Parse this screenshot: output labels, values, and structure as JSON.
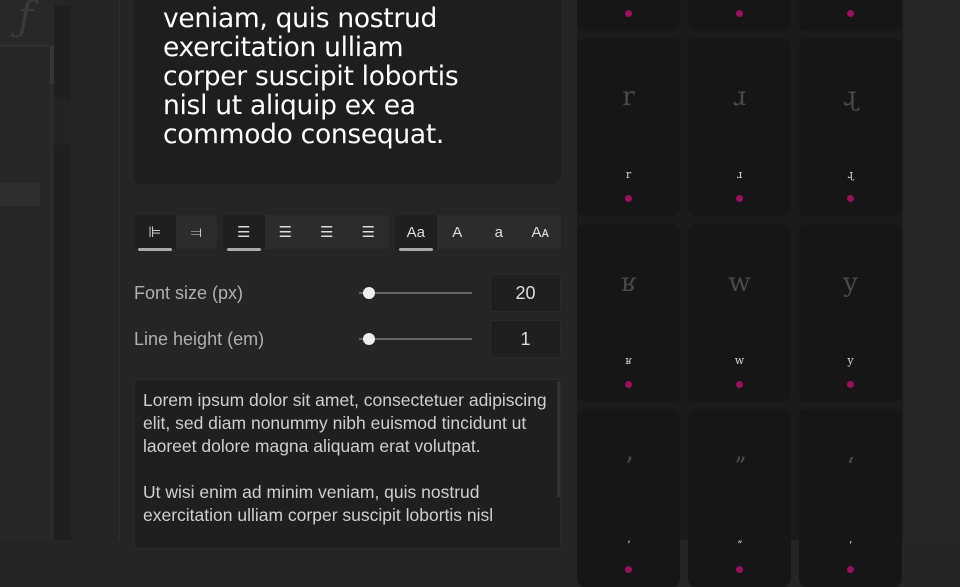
{
  "left_panel": {
    "logo_glyph": "ƒ"
  },
  "preview": {
    "text": "veniam, quis nostrud\nexercitation ulliam\ncorper suscipit lobortis\nnisl ut aliquip ex ea\ncommodo consequat."
  },
  "toolbar": {
    "direction": [
      {
        "name": "ltr",
        "glyph": "⊫",
        "active": true
      },
      {
        "name": "rtl",
        "glyph": "⫤",
        "active": false
      }
    ],
    "align": [
      {
        "name": "align-left",
        "glyph": "☰",
        "active": true
      },
      {
        "name": "align-center",
        "glyph": "☰",
        "active": false
      },
      {
        "name": "align-right",
        "glyph": "☰",
        "active": false
      },
      {
        "name": "justify",
        "glyph": "☰",
        "active": false
      }
    ],
    "case": [
      {
        "name": "mixed-case",
        "glyph": "Aa",
        "active": true
      },
      {
        "name": "uppercase",
        "glyph": "A",
        "active": false
      },
      {
        "name": "lowercase",
        "glyph": "a",
        "active": false
      },
      {
        "name": "small-caps",
        "glyph": "Aᴀ",
        "active": false
      }
    ]
  },
  "font_size": {
    "label": "Font size (px)",
    "value": "20",
    "slider_fraction": 0.05
  },
  "line_height": {
    "label": "Line height (em)",
    "value": "1",
    "slider_fraction": 0.05
  },
  "sample_text": "Lorem ipsum dolor sit amet, consectetuer adipiscing elit, sed diam nonummy nibh euismod tincidunt ut laoreet dolore magna aliquam erat volutpat.\n\nUt wisi enim ad minim veniam, quis nostrud exercitation ulliam corper suscipit lobortis nisl",
  "glyphs": {
    "accent_color": "#9c0f5f",
    "rows": [
      [
        {
          "big": "",
          "small": ""
        },
        {
          "big": "",
          "small": ""
        },
        {
          "big": "",
          "small": ""
        }
      ],
      [
        {
          "big": "r",
          "small": "r"
        },
        {
          "big": "ɹ",
          "small": "ɹ"
        },
        {
          "big": "ɻ",
          "small": "ɻ"
        }
      ],
      [
        {
          "big": "ʁ",
          "small": "ʁ"
        },
        {
          "big": "w",
          "small": "w"
        },
        {
          "big": "y",
          "small": "y"
        }
      ],
      [
        {
          "big": "ʼ",
          "small": "ʼ"
        },
        {
          "big": "ˮ",
          "small": "ˮ"
        },
        {
          "big": "ʻ",
          "small": "ʻ"
        }
      ]
    ]
  }
}
